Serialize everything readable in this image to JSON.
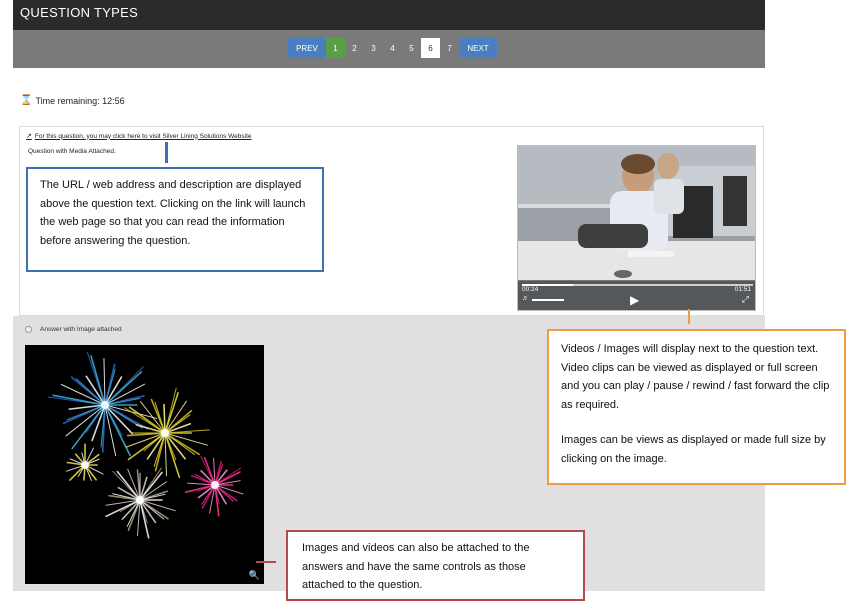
{
  "header": {
    "title": "QUESTION TYPES"
  },
  "pager": {
    "prev_label": "PREV",
    "next_label": "NEXT",
    "pages": [
      "1",
      "2",
      "3",
      "4",
      "5",
      "6",
      "7"
    ],
    "answered_page": "1",
    "current_page": "6"
  },
  "timer": {
    "text": "Time remaining: 12:56"
  },
  "question": {
    "link_text": "For this question, you may click here to visit Silver Lining Solutions Website",
    "text": "Question with Media Attached."
  },
  "video": {
    "elapsed": "00:24",
    "duration": "01:51",
    "progress_fraction": 0.22
  },
  "answer": {
    "label": "Answer with Image attached"
  },
  "callouts": {
    "url": "The URL / web address and description are displayed above the question text. Clicking on the link will launch the web page so that you can read the information before answering the question.",
    "media_p1": "Videos / Images will display next to the question text. Video clips can be viewed as displayed or full screen and you can play / pause / rewind / fast forward the clip as required.",
    "media_p2": "Images can be views as displayed or made full size by clicking on the image.",
    "answer": "Images and videos can also be attached to the answers and have the same controls as those attached to the question."
  },
  "colors": {
    "header_bg": "#2b2b2b",
    "pager_bg": "#7a7a7a",
    "nav_button": "#4a7fbf",
    "answered_page": "#5a9e46",
    "callout_blue": "#3e6fae",
    "callout_orange": "#f29a42",
    "callout_red": "#b64a4a"
  },
  "icons": {
    "timer": "hourglass-icon",
    "link": "external-link-icon",
    "play": "play-icon",
    "volume": "volume-icon",
    "fullscreen": "fullscreen-icon",
    "zoom": "search-icon"
  }
}
